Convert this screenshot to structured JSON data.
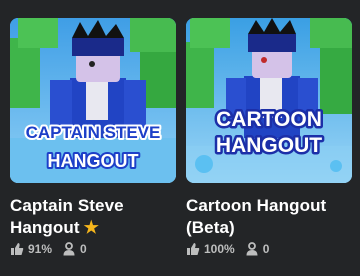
{
  "games": [
    {
      "title_line1": "Captain Steve",
      "title_line2": "Hangout",
      "thumbnail_text_line1": "CAPTAIN STEVE",
      "thumbnail_text_line2": "HANGOUT",
      "has_star": true,
      "star_icon": "star-icon",
      "rating": "91%",
      "players": "0"
    },
    {
      "title_line1": "Cartoon Hangout",
      "title_line2": "(Beta)",
      "thumbnail_text_line1": "CARTOON",
      "thumbnail_text_line2": "HANGOUT",
      "has_star": false,
      "rating": "100%",
      "players": "0"
    }
  ],
  "icons": {
    "rating": "thumbs-up-icon",
    "players": "person-icon"
  },
  "colors": {
    "background": "#232527",
    "title": "#ffffff",
    "stats": "#bdbebe",
    "star": "#f6b61c",
    "thumb_sky": "#5fb2ea",
    "thumb_avatar_blue": "#1f3fb8"
  }
}
